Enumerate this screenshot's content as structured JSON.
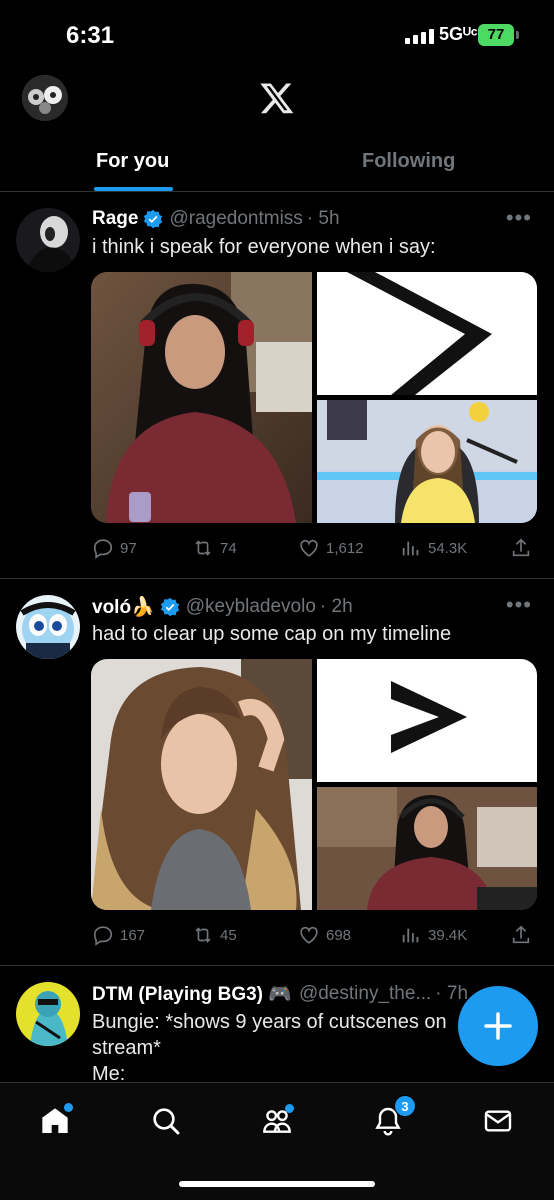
{
  "status_bar": {
    "time": "6:31",
    "network": "5Gᵁᶜ",
    "battery": "77"
  },
  "tabs": [
    {
      "label": "For you",
      "active": true
    },
    {
      "label": "Following",
      "active": false
    }
  ],
  "posts": [
    {
      "name": "Rage",
      "handle": "@ragedontmiss",
      "time": "· 5h",
      "text": "i think i speak for everyone when i say:",
      "replies": "97",
      "reposts": "74",
      "likes": "1,612",
      "views": "54.3K"
    },
    {
      "name": "voló🍌",
      "handle": "@keybladevolo",
      "time": "· 2h",
      "text": "had to clear up some cap on my timeline",
      "replies": "167",
      "reposts": "45",
      "likes": "698",
      "views": "39.4K"
    },
    {
      "name": "DTM (Playing BG3) 🎮",
      "handle": "@destiny_the...",
      "time": "· 7h",
      "text_line1": "Bungie: *shows 9 years of cutscenes on",
      "text_line2": "stream*",
      "text_line3": "Me:"
    }
  ],
  "notifications_badge": "3",
  "colors": {
    "accent": "#1d9bf0",
    "muted": "#71767b",
    "background": "#000000"
  },
  "icons": [
    "x-logo-icon",
    "verified-icon",
    "reply-icon",
    "repost-icon",
    "like-icon",
    "views-icon",
    "share-icon",
    "home-icon",
    "search-icon",
    "communities-icon",
    "notifications-icon",
    "messages-icon",
    "compose-icon"
  ]
}
